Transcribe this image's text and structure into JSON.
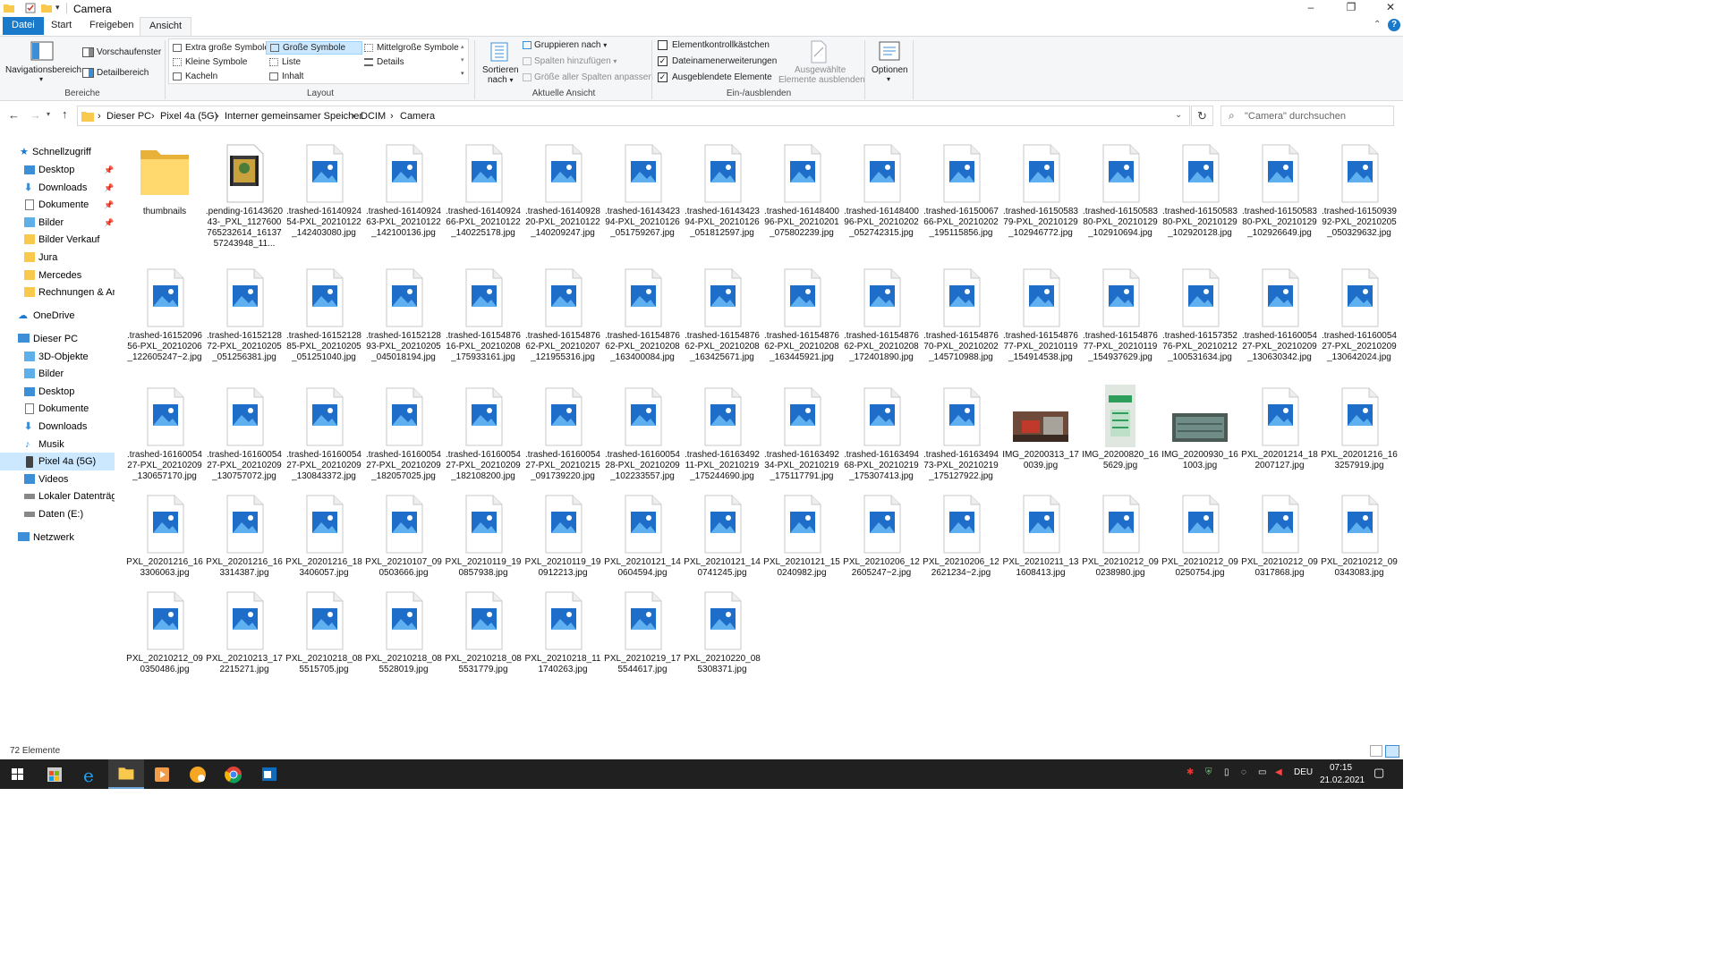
{
  "window": {
    "title": "Camera",
    "minimize": "–",
    "maximize": "❐",
    "close": "✕"
  },
  "tabs": [
    "Datei",
    "Start",
    "Freigeben",
    "Ansicht"
  ],
  "ribbon": {
    "bereiche": {
      "group": "Bereiche",
      "navigationsbereich": "Navigationsbereich",
      "vorschaufenster": "Vorschaufenster",
      "detailbereich": "Detailbereich"
    },
    "layout": {
      "group": "Layout",
      "items": [
        "Extra große Symbole",
        "Große Symbole",
        "Mittelgroße Symbole",
        "Kleine Symbole",
        "Liste",
        "Details",
        "Kacheln",
        "Inhalt"
      ],
      "selected": "Große Symbole"
    },
    "aktuelle_ansicht": {
      "group": "Aktuelle Ansicht",
      "sortieren": "Sortieren",
      "nach": "nach",
      "gruppieren": "Gruppieren nach",
      "spalten_hinzufuegen": "Spalten hinzufügen",
      "groesse_spalten": "Größe aller Spalten anpassen"
    },
    "einaus": {
      "group": "Ein-/ausblenden",
      "elementkontrollkaestchen": "Elementkontrollkästchen",
      "dateinamenerweiterungen": "Dateinamenerweiterungen",
      "ausgeblendete_elemente": "Ausgeblendete Elemente",
      "checked": [
        false,
        true,
        true
      ],
      "ausgewaehlte1": "Ausgewählte",
      "ausgewaehlte2": "Elemente ausblenden"
    },
    "optionen": "Optionen"
  },
  "address": {
    "crumbs": [
      "Dieser PC",
      "Pixel 4a (5G)",
      "Interner gemeinsamer Speicher",
      "DCIM",
      "Camera"
    ],
    "search_placeholder": "\"Camera\" durchsuchen"
  },
  "nav": {
    "quick": "Schnellzugriff",
    "quick_items": [
      "Desktop",
      "Downloads",
      "Dokumente",
      "Bilder",
      "Bilder Verkauf",
      "Jura",
      "Mercedes",
      "Rechnungen & Anle"
    ],
    "onedrive": "OneDrive",
    "thispc": "Dieser PC",
    "pc_items": [
      "3D-Objekte",
      "Bilder",
      "Desktop",
      "Dokumente",
      "Downloads",
      "Musik",
      "Pixel 4a (5G)",
      "Videos",
      "Lokaler Datenträger",
      "Daten (E:)"
    ],
    "network": "Netzwerk"
  },
  "files": [
    {
      "name": "thumbnails",
      "type": "folder"
    },
    {
      "name": ".pending-1614362043-_PXL_1127600765232614_1613757243948_11...",
      "type": "video"
    },
    {
      "name": ".trashed-1614092454-PXL_20210122_142403080.jpg",
      "type": "img"
    },
    {
      "name": ".trashed-1614092463-PXL_20210122_142100136.jpg",
      "type": "img"
    },
    {
      "name": ".trashed-1614092466-PXL_20210122_140225178.jpg",
      "type": "img"
    },
    {
      "name": ".trashed-1614092820-PXL_20210122_140209247.jpg",
      "type": "img"
    },
    {
      "name": ".trashed-1614342394-PXL_20210126_051759267.jpg",
      "type": "img"
    },
    {
      "name": ".trashed-1614342394-PXL_20210126_051812597.jpg",
      "type": "img"
    },
    {
      "name": ".trashed-1614840096-PXL_20210201_075802239.jpg",
      "type": "img"
    },
    {
      "name": ".trashed-1614840096-PXL_20210202_052742315.jpg",
      "type": "img"
    },
    {
      "name": ".trashed-1615006766-PXL_20210202_195115856.jpg",
      "type": "img"
    },
    {
      "name": ".trashed-1615058379-PXL_20210129_102946772.jpg",
      "type": "img"
    },
    {
      "name": ".trashed-1615058380-PXL_20210129_102910694.jpg",
      "type": "img"
    },
    {
      "name": ".trashed-1615058380-PXL_20210129_102920128.jpg",
      "type": "img"
    },
    {
      "name": ".trashed-1615058380-PXL_20210129_102926649.jpg",
      "type": "img"
    },
    {
      "name": ".trashed-1615093992-PXL_20210205_050329632.jpg",
      "type": "img"
    },
    {
      "name": ".trashed-1615209656-PXL_20210206_122605247~2.jpg",
      "type": "img"
    },
    {
      "name": ".trashed-1615212872-PXL_20210205_051256381.jpg",
      "type": "img"
    },
    {
      "name": ".trashed-1615212885-PXL_20210205_051251040.jpg",
      "type": "img"
    },
    {
      "name": ".trashed-1615212893-PXL_20210205_045018194.jpg",
      "type": "img"
    },
    {
      "name": ".trashed-1615487616-PXL_20210208_175933161.jpg",
      "type": "img"
    },
    {
      "name": ".trashed-1615487662-PXL_20210207_121955316.jpg",
      "type": "img"
    },
    {
      "name": ".trashed-1615487662-PXL_20210208_163400084.jpg",
      "type": "img"
    },
    {
      "name": ".trashed-1615487662-PXL_20210208_163425671.jpg",
      "type": "img"
    },
    {
      "name": ".trashed-1615487662-PXL_20210208_163445921.jpg",
      "type": "img"
    },
    {
      "name": ".trashed-1615487662-PXL_20210208_172401890.jpg",
      "type": "img"
    },
    {
      "name": ".trashed-1615487670-PXL_20210202_145710988.jpg",
      "type": "img"
    },
    {
      "name": ".trashed-1615487677-PXL_20210119_154914538.jpg",
      "type": "img"
    },
    {
      "name": ".trashed-1615487677-PXL_20210119_154937629.jpg",
      "type": "img"
    },
    {
      "name": ".trashed-1615735276-PXL_20210212_100531634.jpg",
      "type": "img"
    },
    {
      "name": ".trashed-1616005427-PXL_20210209_130630342.jpg",
      "type": "img"
    },
    {
      "name": ".trashed-1616005427-PXL_20210209_130642024.jpg",
      "type": "img"
    },
    {
      "name": ".trashed-1616005427-PXL_20210209_130657170.jpg",
      "type": "img"
    },
    {
      "name": ".trashed-1616005427-PXL_20210209_130757072.jpg",
      "type": "img"
    },
    {
      "name": ".trashed-1616005427-PXL_20210209_130843372.jpg",
      "type": "img"
    },
    {
      "name": ".trashed-1616005427-PXL_20210209_182057025.jpg",
      "type": "img"
    },
    {
      "name": ".trashed-1616005427-PXL_20210209_182108200.jpg",
      "type": "img"
    },
    {
      "name": ".trashed-1616005427-PXL_20210215_091739220.jpg",
      "type": "img"
    },
    {
      "name": ".trashed-1616005428-PXL_20210209_102233557.jpg",
      "type": "img"
    },
    {
      "name": ".trashed-1616349211-PXL_20210219_175244690.jpg",
      "type": "img"
    },
    {
      "name": ".trashed-1616349234-PXL_20210219_175117791.jpg",
      "type": "img"
    },
    {
      "name": ".trashed-1616349468-PXL_20210219_175307413.jpg",
      "type": "img"
    },
    {
      "name": ".trashed-1616349473-PXL_20210219_175127922.jpg",
      "type": "img"
    },
    {
      "name": "IMG_20200313_170039.jpg",
      "type": "photo1"
    },
    {
      "name": "IMG_20200820_165629.jpg",
      "type": "photo2"
    },
    {
      "name": "IMG_20200930_161003.jpg",
      "type": "photo3"
    },
    {
      "name": "PXL_20201214_182007127.jpg",
      "type": "img"
    },
    {
      "name": "PXL_20201216_163257919.jpg",
      "type": "img"
    },
    {
      "name": "PXL_20201216_163306063.jpg",
      "type": "img"
    },
    {
      "name": "PXL_20201216_163314387.jpg",
      "type": "img"
    },
    {
      "name": "PXL_20201216_183406057.jpg",
      "type": "img"
    },
    {
      "name": "PXL_20210107_090503666.jpg",
      "type": "img"
    },
    {
      "name": "PXL_20210119_190857938.jpg",
      "type": "img"
    },
    {
      "name": "PXL_20210119_190912213.jpg",
      "type": "img"
    },
    {
      "name": "PXL_20210121_140604594.jpg",
      "type": "img"
    },
    {
      "name": "PXL_20210121_140741245.jpg",
      "type": "img"
    },
    {
      "name": "PXL_20210121_150240982.jpg",
      "type": "img"
    },
    {
      "name": "PXL_20210206_122605247~2.jpg",
      "type": "img"
    },
    {
      "name": "PXL_20210206_122621234~2.jpg",
      "type": "img"
    },
    {
      "name": "PXL_20210211_131608413.jpg",
      "type": "img"
    },
    {
      "name": "PXL_20210212_090238980.jpg",
      "type": "img"
    },
    {
      "name": "PXL_20210212_090250754.jpg",
      "type": "img"
    },
    {
      "name": "PXL_20210212_090317868.jpg",
      "type": "img"
    },
    {
      "name": "PXL_20210212_090343083.jpg",
      "type": "img"
    },
    {
      "name": "PXL_20210212_090350486.jpg",
      "type": "img"
    },
    {
      "name": "PXL_20210213_172215271.jpg",
      "type": "img"
    },
    {
      "name": "PXL_20210218_085515705.jpg",
      "type": "img"
    },
    {
      "name": "PXL_20210218_085528019.jpg",
      "type": "img"
    },
    {
      "name": "PXL_20210218_085531779.jpg",
      "type": "img"
    },
    {
      "name": "PXL_20210218_111740263.jpg",
      "type": "img"
    },
    {
      "name": "PXL_20210219_175544617.jpg",
      "type": "img"
    },
    {
      "name": "PXL_20210220_085308371.jpg",
      "type": "img"
    }
  ],
  "status": {
    "count": "72 Elemente"
  },
  "taskbar": {
    "lang": "DEU",
    "time": "07:15",
    "date": "21.02.2021"
  },
  "colors": {
    "accent": "#1979ca",
    "selection": "#cce8ff",
    "taskbar": "#202020",
    "folder": "#ffd86e"
  }
}
